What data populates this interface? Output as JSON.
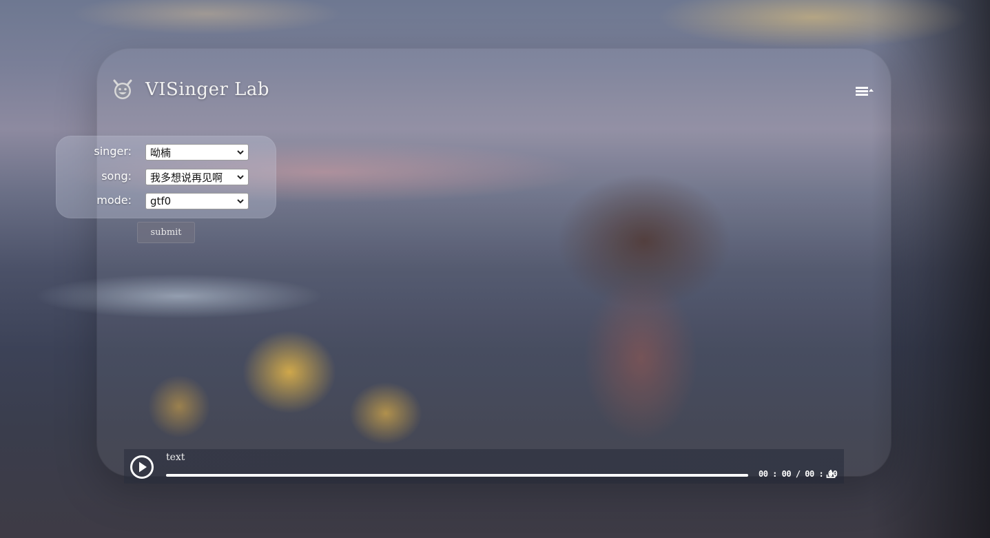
{
  "app": {
    "title": "VISinger Lab",
    "logo_icon": "smiling-devil-icon",
    "menu_icon": "menu-list-icon"
  },
  "form": {
    "singer": {
      "label": "singer:",
      "value": "呦楠"
    },
    "song": {
      "label": "song:",
      "value": "我多想说再见啊"
    },
    "mode": {
      "label": "mode:",
      "value": "gtf0"
    },
    "submit_label": "submit"
  },
  "player": {
    "track_title": "text",
    "current_time": "00 : 00",
    "separator": "/",
    "duration": "00 : 00",
    "progress_fraction": 1.0,
    "play_icon": "play-icon",
    "download_icon": "download-icon"
  },
  "colors": {
    "text": "#ffffff",
    "progress": "#ffffff",
    "button_bg": "#6e7080"
  }
}
